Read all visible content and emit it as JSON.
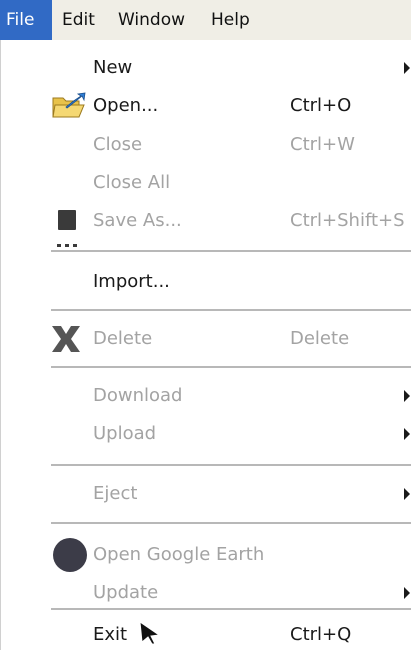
{
  "menubar": {
    "items": [
      {
        "label": "File"
      },
      {
        "label": "Edit"
      },
      {
        "label": "Window"
      },
      {
        "label": "Help"
      }
    ]
  },
  "menu": {
    "new": {
      "label": "New"
    },
    "open": {
      "label": "Open...",
      "shortcut": "Ctrl+O"
    },
    "close": {
      "label": "Close",
      "shortcut": "Ctrl+W"
    },
    "close_all": {
      "label": "Close All"
    },
    "save_as": {
      "label": "Save As...",
      "shortcut": "Ctrl+Shift+S"
    },
    "import": {
      "label": "Import..."
    },
    "delete": {
      "label": "Delete",
      "shortcut": "Delete"
    },
    "download": {
      "label": "Download"
    },
    "upload": {
      "label": "Upload"
    },
    "eject": {
      "label": "Eject"
    },
    "open_google_earth": {
      "label": "Open Google Earth"
    },
    "update": {
      "label": "Update"
    },
    "exit": {
      "label": "Exit",
      "shortcut": "Ctrl+Q"
    }
  },
  "icons": {
    "open": "folder-open-icon",
    "save_as": "save-icon",
    "delete": "delete-x-icon",
    "google_earth": "globe-icon",
    "submenu": "submenu-arrow-icon"
  },
  "colors": {
    "menubar_bg": "#f0eee6",
    "active_highlight": "#316ac5",
    "disabled_text": "#a3a3a3",
    "separator": "#b8b8b8"
  }
}
